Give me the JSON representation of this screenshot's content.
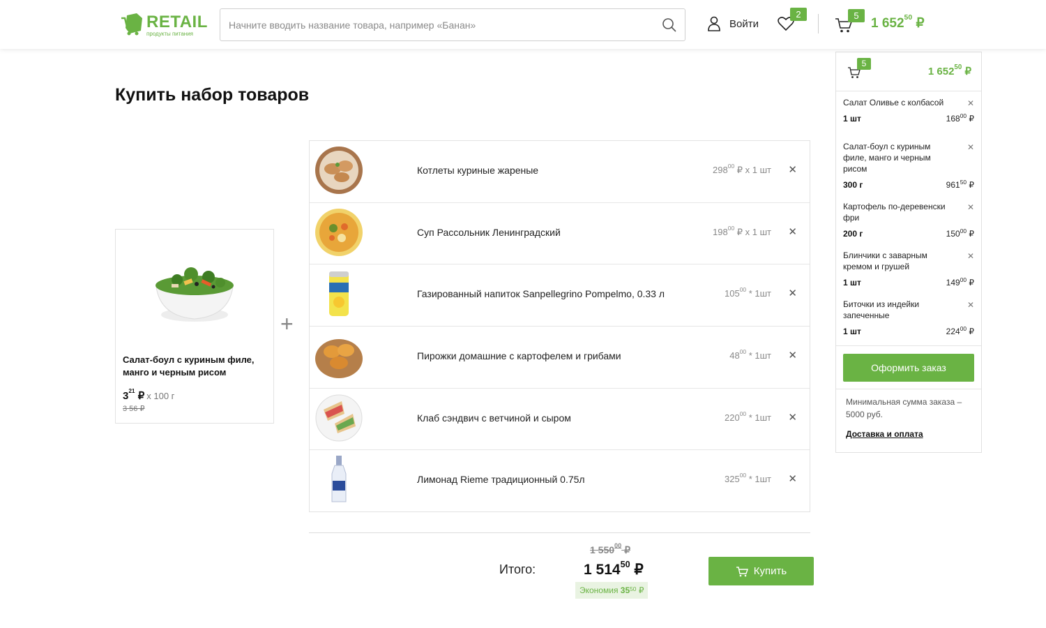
{
  "header": {
    "logo_text": "RETAIL",
    "logo_sub": "продукты питания",
    "search_placeholder": "Начните вводить название товара, например «Банан»",
    "login_label": "Войти",
    "favorites_count": "2",
    "cart_count": "5",
    "cart_total_main": "1 652",
    "cart_total_cents": "50",
    "currency": "₽"
  },
  "page": {
    "title": "Купить набор товаров"
  },
  "main_product": {
    "name": "Салат-боул с куриным филе, манго и черным рисом",
    "price_main": "3",
    "price_cents": "21",
    "currency": "₽",
    "unit": "x 100 г",
    "old_price": "3 56 ₽"
  },
  "set_items": [
    {
      "name": "Котлеты куриные жареные",
      "price": "298",
      "cents": "00",
      "qty": "₽ x 1 шт"
    },
    {
      "name": "Суп Рассольник Ленинградский",
      "price": "198",
      "cents": "00",
      "qty": "₽ x 1 шт"
    },
    {
      "name": "Газированный напиток Sanpellegrino Pompelmo, 0.33 л",
      "price": "105",
      "cents": "00",
      "qty": "* 1шт"
    },
    {
      "name": "Пирожки домашние с картофелем и грибами",
      "price": "48",
      "cents": "00",
      "qty": "* 1шт"
    },
    {
      "name": "Клаб сэндвич с ветчиной и сыром",
      "price": "220",
      "cents": "00",
      "qty": "* 1шт"
    },
    {
      "name": "Лимонад Rieme традиционный 0.75л",
      "price": "325",
      "cents": "00",
      "qty": "* 1шт"
    }
  ],
  "summary": {
    "label": "Итого:",
    "old_main": "1 550",
    "old_cents": "00",
    "new_main": "1 514",
    "new_cents": "50",
    "currency": "₽",
    "saving_label": "Экономия",
    "saving_main": "35",
    "saving_cents": "50",
    "buy_label": "Купить"
  },
  "mini_cart": {
    "count": "5",
    "total_main": "1 652",
    "total_cents": "50",
    "currency": "₽",
    "items": [
      {
        "name": "Салат Оливье с колбасой",
        "qty": "1 шт",
        "price": "168",
        "cents": "00"
      },
      {
        "name": "Салат-боул с куриным филе, манго и черным рисом",
        "qty": "300 г",
        "price": "961",
        "cents": "50"
      },
      {
        "name": "Картофель по-деревенски фри",
        "qty": "200 г",
        "price": "150",
        "cents": "00"
      },
      {
        "name": "Блинчики с заварным кремом и грушей",
        "qty": "1 шт",
        "price": "149",
        "cents": "00"
      },
      {
        "name": "Биточки из индейки запеченные",
        "qty": "1 шт",
        "price": "224",
        "cents": "00"
      }
    ],
    "order_button": "Оформить заказ",
    "min_sum_text": "Минимальная сумма заказа – 5000 руб.",
    "delivery_link": "Доставка и оплата"
  },
  "colors": {
    "accent": "#6ab344"
  }
}
